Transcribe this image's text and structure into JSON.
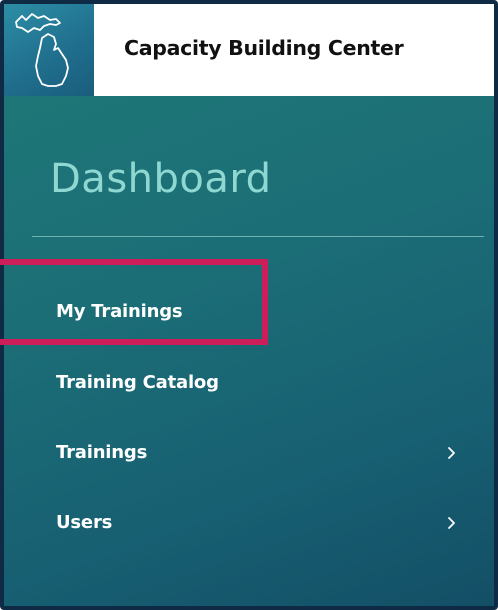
{
  "header": {
    "brand_title": "Capacity Building Center",
    "logo_icon": "michigan-state-outline-icon"
  },
  "sidebar": {
    "section_title": "Dashboard",
    "items": [
      {
        "label": "My Trainings",
        "has_submenu": false,
        "highlighted": true
      },
      {
        "label": "Training Catalog",
        "has_submenu": false,
        "highlighted": false
      },
      {
        "label": "Trainings",
        "has_submenu": true,
        "highlighted": false
      },
      {
        "label": "Users",
        "has_submenu": true,
        "highlighted": false
      }
    ]
  },
  "colors": {
    "panel_gradient_start": "#1f7a78",
    "panel_gradient_end": "#134f66",
    "frame_border": "#0e2a44",
    "section_title": "#8fd8d2",
    "nav_text": "#ffffff",
    "highlight_box": "#cc1f5a",
    "logo_tile": "#1f6d8c"
  }
}
